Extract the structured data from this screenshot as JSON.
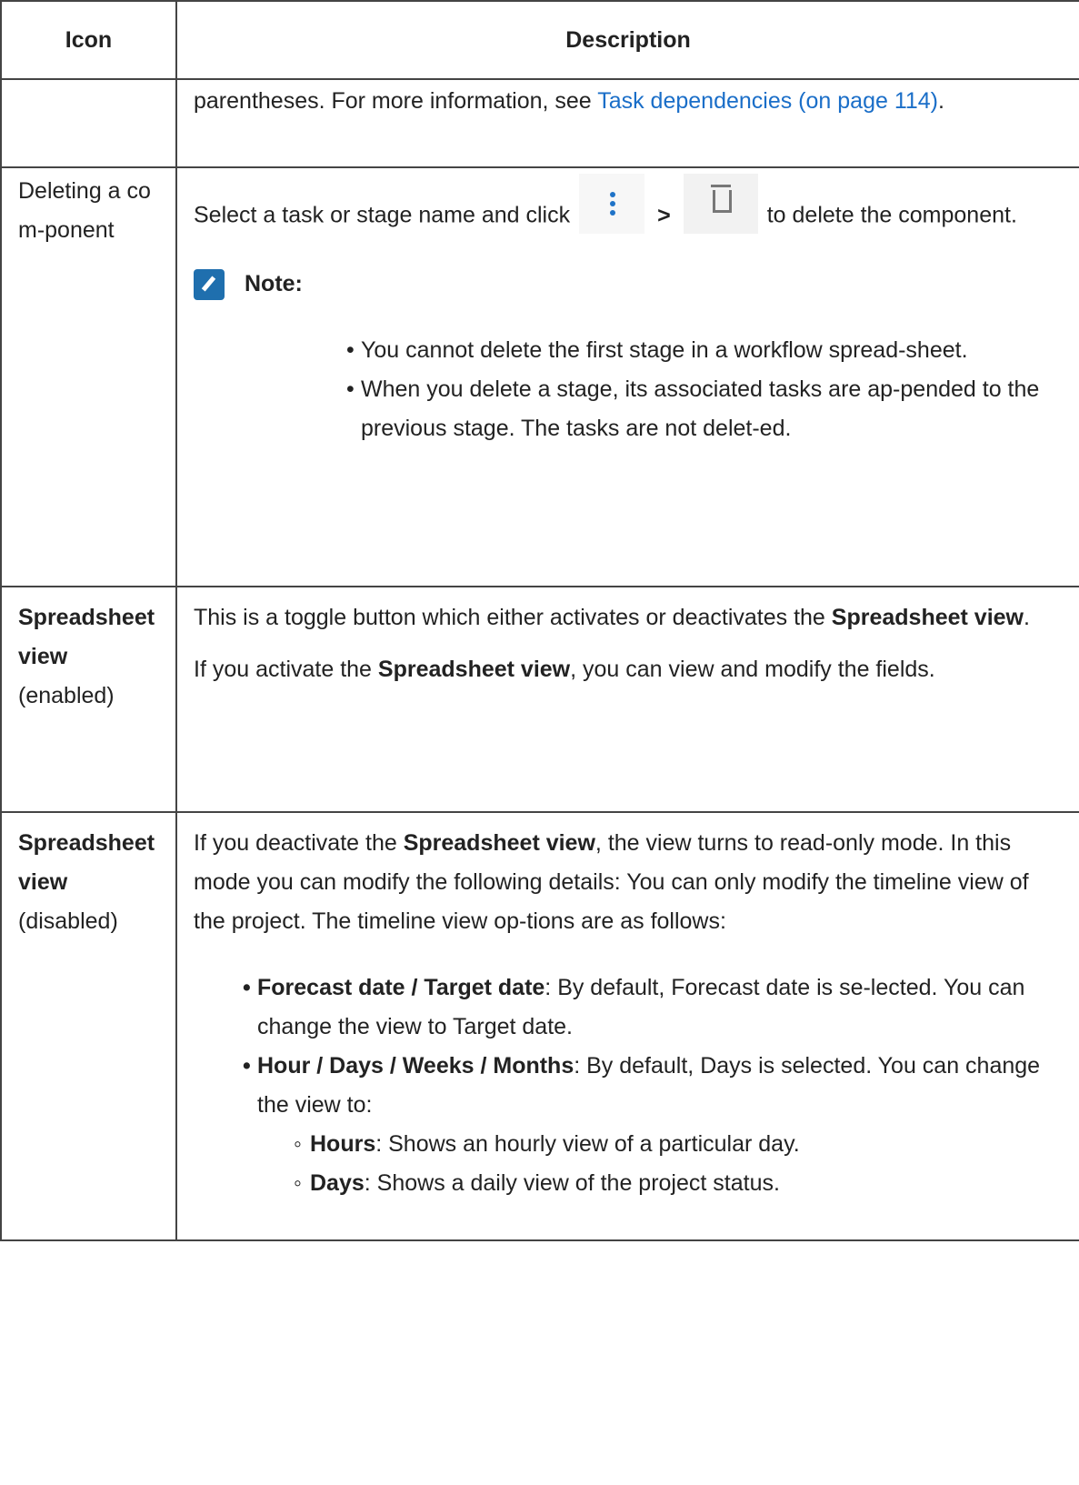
{
  "table": {
    "headers": {
      "icon": "Icon",
      "description": "Description"
    },
    "row_continued": {
      "text_before": "parentheses. For more information, see ",
      "link_text": "Task dependencies (on page 114)",
      "text_after": "."
    },
    "row_delete": {
      "icon_label": "Deleting a com-ponent",
      "desc_before": "Select a task or stage name and click",
      "separator": ">",
      "desc_after": "to delete the component.",
      "menu_icon": "more-vertical-icon",
      "delete_icon": "trash-icon",
      "note_label": "Note:",
      "note_items": [
        "You cannot delete the first stage in a workflow spread-sheet.",
        "When you delete a stage, its associated tasks are ap-pended to the previous stage. The tasks are not delet-ed."
      ]
    },
    "row_enabled": {
      "icon_bold": "Spreadsheet view",
      "icon_suffix": "(enabled)",
      "p1_before": "This is a toggle button which either activates or deactivates the ",
      "p1_bold": "Spreadsheet view",
      "p1_after": ".",
      "p2_before": "If you activate the ",
      "p2_bold": "Spreadsheet view",
      "p2_after": ", you can view and modify the fields."
    },
    "row_disabled": {
      "icon_bold": "Spreadsheet view",
      "icon_suffix": "(disabled)",
      "p1_before": "If you deactivate the ",
      "p1_bold": "Spreadsheet view",
      "p1_after": ", the view turns to read-only mode. In this mode you can modify the following details: You can only modify the timeline view of the project. The timeline view op-tions are as follows:",
      "items": [
        {
          "bold": "Forecast date / Target date",
          "text": ": By default, Forecast date is se-lected. You can change the view to Target date."
        },
        {
          "bold": "Hour / Days / Weeks / Months",
          "text": ": By default, Days is selected. You can change the view to:"
        }
      ],
      "sub_items": [
        {
          "bold": "Hours",
          "text": ": Shows an hourly view of a particular day."
        },
        {
          "bold": "Days",
          "text": ": Shows a daily view of the project status."
        }
      ]
    }
  }
}
